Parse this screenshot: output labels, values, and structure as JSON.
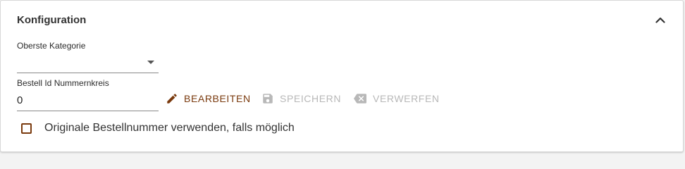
{
  "panel": {
    "title": "Konfiguration",
    "collapse_icon": "chevron-up-icon"
  },
  "fields": {
    "category": {
      "label": "Oberste Kategorie",
      "value": ""
    },
    "order_id": {
      "label": "Bestell Id Nummernkreis",
      "value": "0"
    }
  },
  "actions": {
    "edit": {
      "label": "BEARBEITEN",
      "icon": "pencil-icon",
      "color": "#7a3a0e"
    },
    "save": {
      "label": "SPEICHERN",
      "icon": "floppy-disk-icon",
      "color": "#b8b8b8"
    },
    "discard": {
      "label": "VERWERFEN",
      "icon": "backspace-icon",
      "color": "#b8b8b8"
    }
  },
  "option": {
    "label": "Originale Bestellnummer verwenden, falls möglich",
    "checked": false
  },
  "colors": {
    "accent": "#7a3a0e",
    "disabled": "#b8b8b8"
  }
}
